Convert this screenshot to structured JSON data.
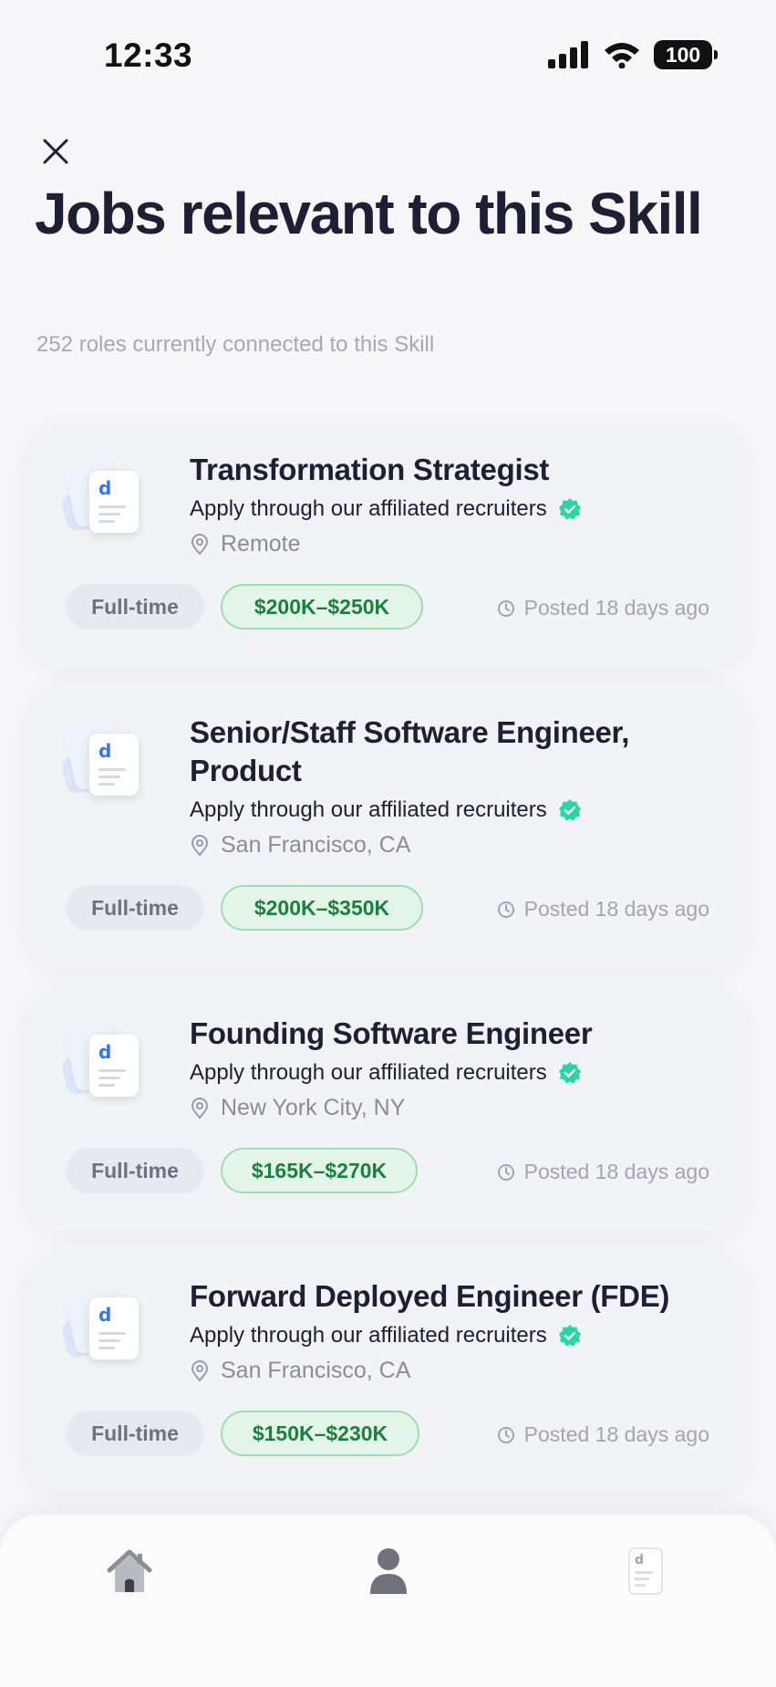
{
  "status_bar": {
    "time": "12:33",
    "battery": "100"
  },
  "header": {
    "title": "Jobs relevant to this Skill",
    "subtitle": "252 roles currently connected to this Skill"
  },
  "jobs": [
    {
      "title": "Transformation Strategist",
      "apply_text": "Apply through our affiliated recruiters",
      "location": "Remote",
      "type": "Full-time",
      "salary": "$200K–$250K",
      "posted": "Posted 18 days ago"
    },
    {
      "title": "Senior/Staff Software Engineer, Product",
      "apply_text": "Apply through our affiliated recruiters",
      "location": "San Francisco, CA",
      "type": "Full-time",
      "salary": "$200K–$350K",
      "posted": "Posted 18 days ago"
    },
    {
      "title": "Founding Software Engineer",
      "apply_text": "Apply through our affiliated recruiters",
      "location": "New York City, NY",
      "type": "Full-time",
      "salary": "$165K–$270K",
      "posted": "Posted 18 days ago"
    },
    {
      "title": "Forward Deployed Engineer (FDE)",
      "apply_text": "Apply through our affiliated recruiters",
      "location": "San Francisco, CA",
      "type": "Full-time",
      "salary": "$150K–$230K",
      "posted": "Posted 18 days ago"
    }
  ],
  "tab_bar": {
    "icons": [
      "house-icon",
      "person-icon",
      "document-icon"
    ]
  },
  "colors": {
    "accent_green": "#1d7f3e",
    "verified_teal": "#2dd4a8",
    "logo_blue": "#2f78f0",
    "title_dark": "#1e1f34"
  },
  "logo_letter": "d"
}
